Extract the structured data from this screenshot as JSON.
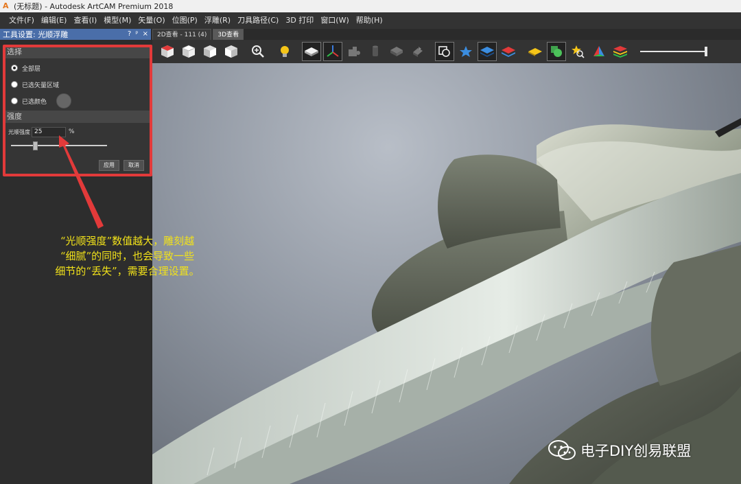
{
  "window": {
    "title": "(无标题) - Autodesk ArtCAM Premium 2018",
    "app_icon": "A"
  },
  "menu": {
    "items": [
      {
        "label": "文件(F)"
      },
      {
        "label": "编辑(E)"
      },
      {
        "label": "查看(I)"
      },
      {
        "label": "模型(M)"
      },
      {
        "label": "矢量(O)"
      },
      {
        "label": "位图(P)"
      },
      {
        "label": "浮雕(R)"
      },
      {
        "label": "刀具路径(C)"
      },
      {
        "label": "3D 打印"
      },
      {
        "label": "窗口(W)"
      },
      {
        "label": "帮助(H)"
      }
    ]
  },
  "panel": {
    "title": "工具设置: 光顺浮雕",
    "ctrl_help": "?",
    "ctrl_pin": "ᵖ",
    "ctrl_close": "×",
    "section_select": "选择",
    "options": [
      {
        "label": "全部层",
        "checked": true
      },
      {
        "label": "已选矢量区域",
        "checked": false
      },
      {
        "label": "已选颜色",
        "checked": false
      }
    ],
    "swatch_color": "#666666",
    "section_strength": "强度",
    "strength_label": "光顺强度",
    "strength_value": "25",
    "strength_unit": "%",
    "strength_slider_fraction": 0.25,
    "apply_label": "应用",
    "cancel_label": "取消",
    "highlight_color": "#e23a3a"
  },
  "tabs": [
    {
      "label": "2D查看 - 111 (4)",
      "active": false
    },
    {
      "label": "3D查看",
      "active": true
    }
  ],
  "toolbar": {
    "icons": [
      "iso-view-icon",
      "top-view-icon",
      "front-view-icon",
      "side-view-icon",
      "zoom-icon",
      "light-bulb-icon",
      "relief-plane-icon",
      "axes-icon",
      "puzzle-icon",
      "cylinder-icon",
      "gray-block-icon",
      "gray-surface-icon",
      "box-shape-icon",
      "blue-star-icon",
      "blue-layer-icon",
      "red-layer-icon",
      "yellow-plane-icon",
      "green-shape-icon",
      "star-search-icon",
      "pyramid-icon",
      "rainbow-layers-icon"
    ],
    "zoom_level": 1.0
  },
  "annotation": {
    "lines": [
      "“光顺强度”数值越大，雕刻越",
      "“细腻”的同时，也会导致一些",
      "细节的“丢失”，需要合理设置。"
    ],
    "color": "#f2e21a"
  },
  "watermark": {
    "text": "电子DIY创易联盟"
  }
}
